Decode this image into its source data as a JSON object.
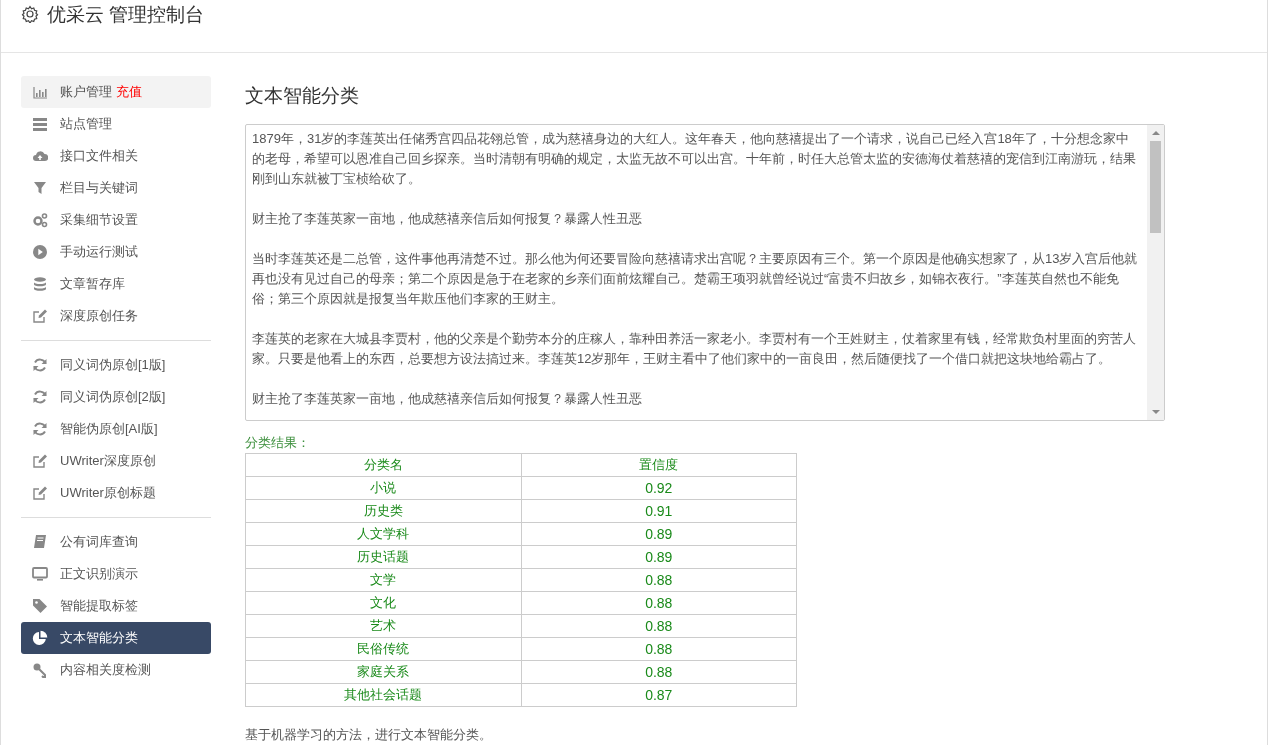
{
  "header": {
    "title": "优采云 管理控制台"
  },
  "sidebar": {
    "groups": [
      {
        "items": [
          {
            "label": "账户管理",
            "badge": "充值",
            "kind": "chart",
            "selected": false,
            "hover": true
          },
          {
            "label": "站点管理",
            "kind": "server",
            "selected": false,
            "hover": false
          },
          {
            "label": "接口文件相关",
            "kind": "cloud",
            "selected": false,
            "hover": false
          },
          {
            "label": "栏目与关键词",
            "kind": "filter",
            "selected": false,
            "hover": false
          },
          {
            "label": "采集细节设置",
            "kind": "gears",
            "selected": false,
            "hover": false
          },
          {
            "label": "手动运行测试",
            "kind": "play",
            "selected": false,
            "hover": false
          },
          {
            "label": "文章暂存库",
            "kind": "database",
            "selected": false,
            "hover": false
          },
          {
            "label": "深度原创任务",
            "kind": "edit",
            "selected": false,
            "hover": false
          }
        ]
      },
      {
        "items": [
          {
            "label": "同义词伪原创[1版]",
            "kind": "refresh",
            "selected": false,
            "hover": false
          },
          {
            "label": "同义词伪原创[2版]",
            "kind": "refresh",
            "selected": false,
            "hover": false
          },
          {
            "label": "智能伪原创[AI版]",
            "kind": "refresh",
            "selected": false,
            "hover": false
          },
          {
            "label": "UWriter深度原创",
            "kind": "edit",
            "selected": false,
            "hover": false
          },
          {
            "label": "UWriter原创标题",
            "kind": "edit",
            "selected": false,
            "hover": false
          }
        ]
      },
      {
        "items": [
          {
            "label": "公有词库查询",
            "kind": "book",
            "selected": false,
            "hover": false
          },
          {
            "label": "正文识别演示",
            "kind": "monitor",
            "selected": false,
            "hover": false
          },
          {
            "label": "智能提取标签",
            "kind": "tag",
            "selected": false,
            "hover": false
          },
          {
            "label": "文本智能分类",
            "kind": "pie",
            "selected": true,
            "hover": false
          },
          {
            "label": "内容相关度检测",
            "kind": "key",
            "selected": false,
            "hover": false
          }
        ]
      }
    ]
  },
  "main": {
    "title": "文本智能分类",
    "text_area": {
      "paragraphs": [
        "1879年，31岁的李莲英出任储秀宫四品花翎总管，成为慈禧身边的大红人。这年春天，他向慈禧提出了一个请求，说自己已经入宫18年了，十分想念家中的老母，希望可以恩准自己回乡探亲。当时清朝有明确的规定，太监无故不可以出宫。十年前，时任大总管太监的安德海仗着慈禧的宠信到江南游玩，结果刚到山东就被丁宝桢给砍了。",
        "财主抢了李莲英家一亩地，他成慈禧亲信后如何报复？暴露人性丑恶",
        "当时李莲英还是二总管，这件事他再清楚不过。那么他为何还要冒险向慈禧请求出宫呢？主要原因有三个。第一个原因是他确实想家了，从13岁入宫后他就再也没有见过自己的母亲；第二个原因是急于在老家的乡亲们面前炫耀自己。楚霸王项羽就曾经说过“富贵不归故乡，如锦衣夜行。”李莲英自然也不能免俗；第三个原因就是报复当年欺压他们李家的王财主。",
        "李莲英的老家在大城县李贾村，他的父亲是个勤劳本分的庄稼人，靠种田养活一家老小。李贾村有一个王姓财主，仗着家里有钱，经常欺负村里面的穷苦人家。只要是他看上的东西，总要想方设法搞过来。李莲英12岁那年，王财主看中了他们家中的一亩良田，然后随便找了一个借口就把这块地给霸占了。",
        "财主抢了李莲英家一亩地，他成慈禧亲信后如何报复？暴露人性丑恶"
      ]
    },
    "result_label": "分类结果：",
    "table": {
      "columns": [
        "分类名",
        "置信度"
      ],
      "rows": [
        [
          "小说",
          "0.92"
        ],
        [
          "历史类",
          "0.91"
        ],
        [
          "人文学科",
          "0.89"
        ],
        [
          "历史话题",
          "0.89"
        ],
        [
          "文学",
          "0.88"
        ],
        [
          "文化",
          "0.88"
        ],
        [
          "艺术",
          "0.88"
        ],
        [
          "民俗传统",
          "0.88"
        ],
        [
          "家庭关系",
          "0.88"
        ],
        [
          "其他社会话题",
          "0.87"
        ]
      ]
    },
    "note": "基于机器学习的方法，进行文本智能分类。"
  }
}
